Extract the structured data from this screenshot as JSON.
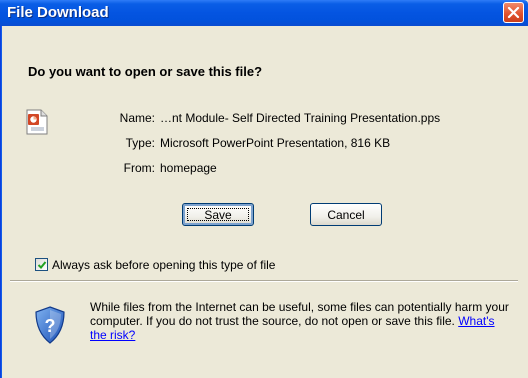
{
  "window": {
    "title": "File Download"
  },
  "dialog": {
    "question": "Do you want to open or save this file?",
    "file": {
      "name_label": "Name:",
      "name_value": "…nt Module- Self Directed Training Presentation.pps",
      "type_label": "Type:",
      "type_value": "Microsoft PowerPoint Presentation, 816 KB",
      "from_label": "From:",
      "from_value": "homepage",
      "icon": "powerpoint-file-icon"
    },
    "buttons": {
      "save_label": "Save",
      "cancel_label": "Cancel"
    },
    "checkbox": {
      "label": "Always ask before opening this type of file",
      "checked": true
    },
    "warning": {
      "text": "While files from the Internet can be useful, some files can potentially harm your computer. If you do not trust the source, do not open or save this file.",
      "link_text": "What's the risk?",
      "icon": "security-shield-icon"
    }
  },
  "colors": {
    "titlebar": "#0454e1",
    "dialog_bg": "#ece9d8",
    "close_button": "#e0502b",
    "link": "#0000ff"
  }
}
